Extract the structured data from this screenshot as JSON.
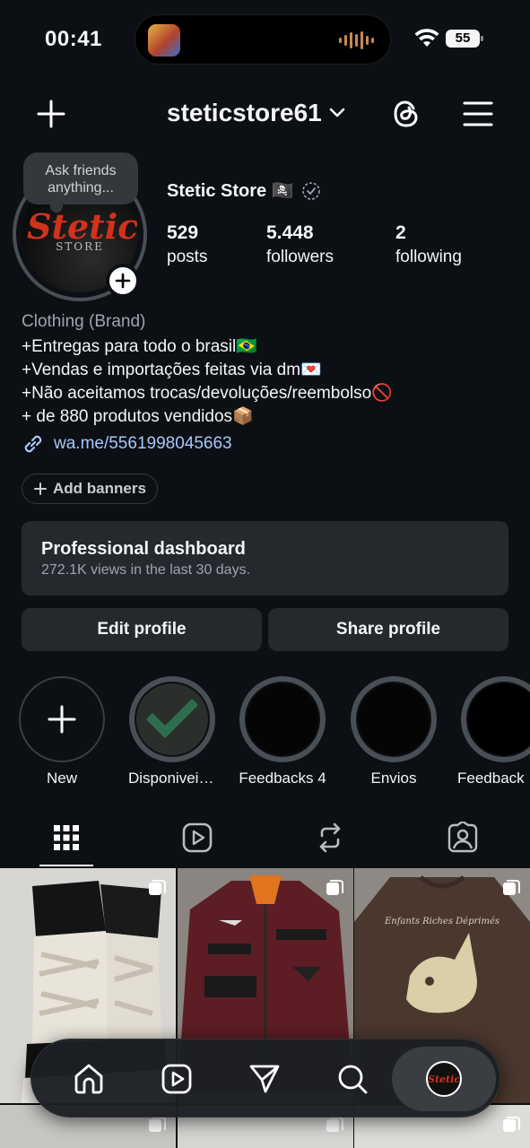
{
  "status": {
    "time": "00:41",
    "battery": "55"
  },
  "header": {
    "username": "steticstore61"
  },
  "note": {
    "text": "Ask friends anything..."
  },
  "profile": {
    "avatar_logo": "Stetic",
    "avatar_sub": "STORE",
    "display_name": "Stetic Store 🏴‍☠️",
    "stats": [
      {
        "value": "529",
        "label": "posts"
      },
      {
        "value": "5.448",
        "label": "followers"
      },
      {
        "value": "2",
        "label": "following"
      }
    ],
    "category": "Clothing (Brand)",
    "bio": [
      "+Entregas para todo o brasil🇧🇷",
      "+Vendas e importações feitas via dm💌",
      "+Não aceitamos trocas/devoluções/reembolso🚫",
      "+ de 880 produtos vendidos📦"
    ],
    "link": "wa.me/5561998045663"
  },
  "actions": {
    "add_banners": "Add banners",
    "dashboard_title": "Professional dashboard",
    "dashboard_sub": "272.1K views in the last 30 days.",
    "edit_profile": "Edit profile",
    "share_profile": "Share profile"
  },
  "highlights": [
    {
      "label": "New"
    },
    {
      "label": "Disponiveis..."
    },
    {
      "label": "Feedbacks 4"
    },
    {
      "label": "Envios"
    },
    {
      "label": "Feedback"
    }
  ],
  "tabs": [
    "grid-icon",
    "reels-icon",
    "reposts-icon",
    "tagged-icon"
  ],
  "nav": [
    "home-icon",
    "reels-icon",
    "direct-icon",
    "search-icon",
    "profile-avatar"
  ],
  "posts": [
    {
      "desc": "sneakers",
      "color": "#c9c6c0"
    },
    {
      "desc": "jacket",
      "color": "#5a1f24"
    },
    {
      "desc": "sweatshirt",
      "color": "#4a372e"
    }
  ],
  "post_print": "Enfants Riches Déprimés"
}
